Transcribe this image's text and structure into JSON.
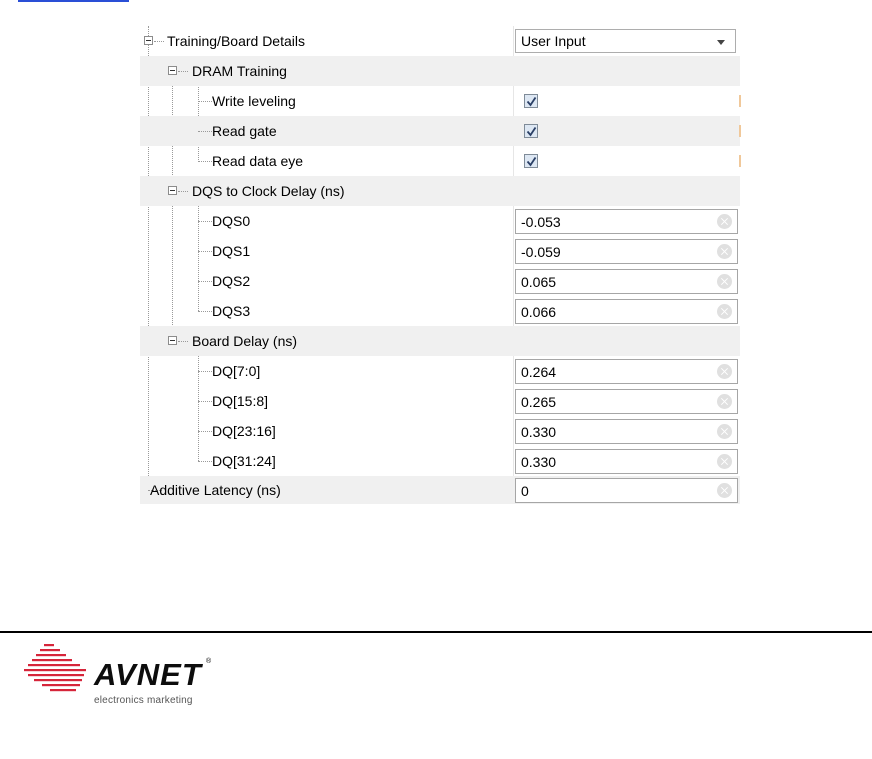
{
  "settings": {
    "training_board": {
      "label": "Training/Board Details",
      "mode_value": "User Input"
    },
    "dram_training": {
      "label": "DRAM Training",
      "items": [
        {
          "label": "Write leveling",
          "checked": true
        },
        {
          "label": "Read gate",
          "checked": true
        },
        {
          "label": "Read data eye",
          "checked": true
        }
      ]
    },
    "dqs_delay": {
      "label": "DQS to Clock Delay (ns)",
      "items": [
        {
          "label": "DQS0",
          "value": "-0.053"
        },
        {
          "label": "DQS1",
          "value": "-0.059"
        },
        {
          "label": "DQS2",
          "value": "0.065"
        },
        {
          "label": "DQS3",
          "value": "0.066"
        }
      ]
    },
    "board_delay": {
      "label": "Board Delay (ns)",
      "items": [
        {
          "label": "DQ[7:0]",
          "value": "0.264"
        },
        {
          "label": "DQ[15:8]",
          "value": "0.265"
        },
        {
          "label": "DQ[23:16]",
          "value": "0.330"
        },
        {
          "label": "DQ[31:24]",
          "value": "0.330"
        }
      ]
    },
    "additive_latency": {
      "label": "Additive Latency (ns)",
      "value": "0"
    }
  },
  "footer": {
    "logo_word": "AVNET",
    "logo_registered": "®",
    "logo_tagline": "electronics marketing",
    "logo_colors": {
      "stripes": "#d6253a",
      "text": "#0d0d0d"
    }
  }
}
